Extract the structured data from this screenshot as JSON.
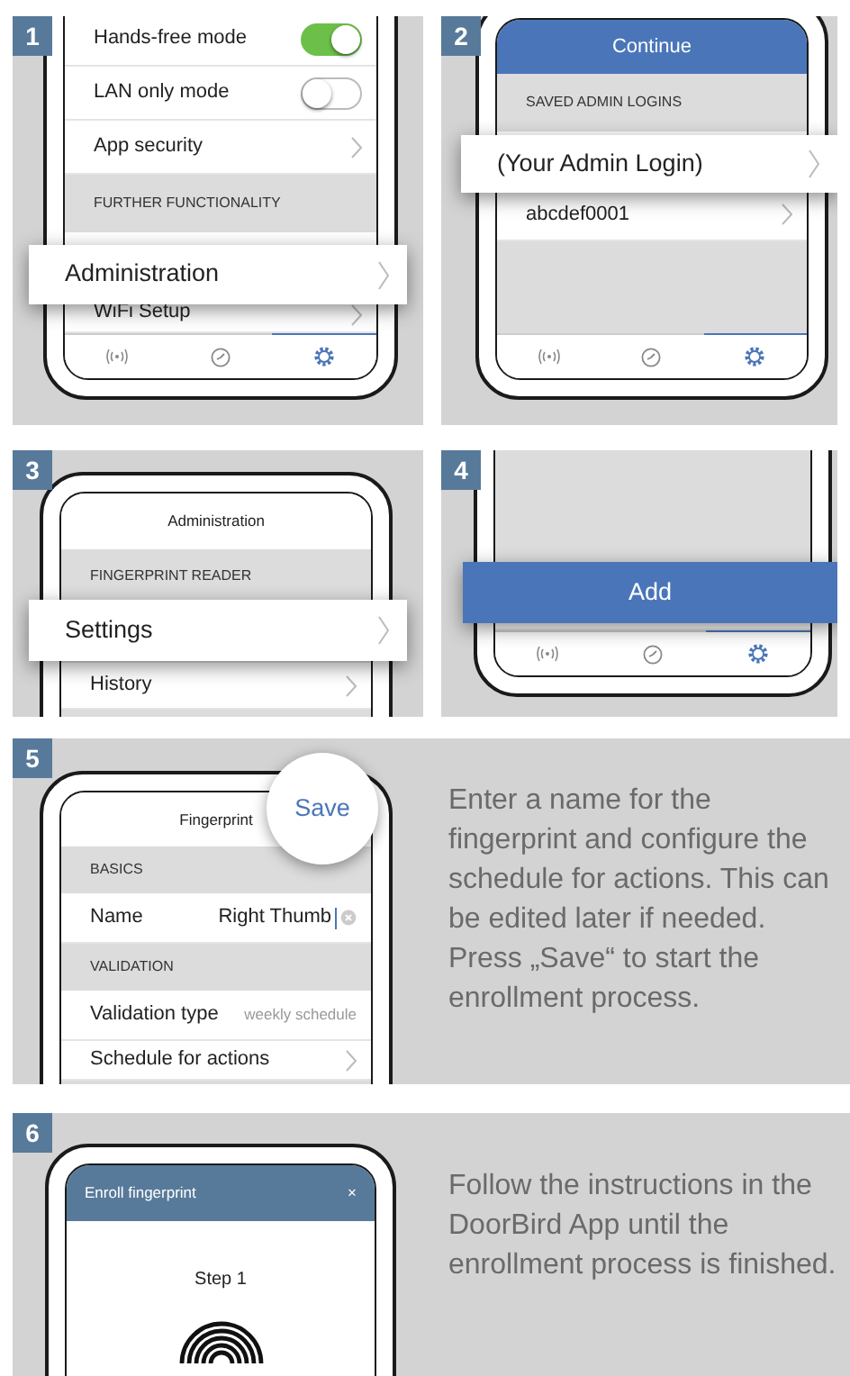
{
  "steps": [
    {
      "number": "1",
      "screen": {
        "rows": [
          {
            "kind": "toggle",
            "label": "Hands-free mode",
            "on": true
          },
          {
            "kind": "toggle",
            "label": "LAN only mode",
            "on": false
          },
          {
            "kind": "link",
            "label": "App security"
          },
          {
            "kind": "header",
            "label": "FURTHER FUNCTIONALITY"
          },
          {
            "kind": "blank"
          },
          {
            "kind": "link",
            "label": "WiFi Setup"
          }
        ]
      },
      "highlight": {
        "kind": "row",
        "label": "Administration"
      },
      "tabs": [
        {
          "kind": "signal",
          "selected": false
        },
        {
          "kind": "clock",
          "selected": false
        },
        {
          "kind": "gear",
          "selected": true
        }
      ]
    },
    {
      "number": "2",
      "screen": {
        "rows": [
          {
            "kind": "action",
            "label": "Continue"
          },
          {
            "kind": "header",
            "label": "SAVED ADMIN LOGINS"
          },
          {
            "kind": "blank"
          },
          {
            "kind": "link",
            "label": "abcdef0001"
          }
        ]
      },
      "highlight": {
        "kind": "row",
        "label": "(Your Admin Login)"
      },
      "tabs": [
        {
          "kind": "signal",
          "selected": false
        },
        {
          "kind": "clock",
          "selected": false
        },
        {
          "kind": "gear",
          "selected": true
        }
      ]
    },
    {
      "number": "3",
      "screen": {
        "rows": [
          {
            "kind": "title",
            "label": "Administration"
          },
          {
            "kind": "header",
            "label": "FINGERPRINT READER"
          },
          {
            "kind": "blank"
          },
          {
            "kind": "link",
            "label": "History"
          }
        ]
      },
      "highlight": {
        "kind": "row",
        "label": "Settings"
      }
    },
    {
      "number": "4",
      "screen": {
        "rows": [
          {
            "kind": "blank"
          }
        ]
      },
      "highlight": {
        "kind": "button",
        "label": "Add"
      },
      "tabs": [
        {
          "kind": "signal",
          "selected": false
        },
        {
          "kind": "clock",
          "selected": false
        },
        {
          "kind": "gear",
          "selected": true
        }
      ]
    },
    {
      "number": "5",
      "screen": {
        "rows": [
          {
            "kind": "title",
            "label": "Fingerprint"
          },
          {
            "kind": "header",
            "label": "BASICS"
          },
          {
            "kind": "input",
            "label": "Name",
            "value": "Right Thumb"
          },
          {
            "kind": "header",
            "label": "VALIDATION"
          },
          {
            "kind": "value",
            "label": "Validation type",
            "value": "weekly schedule"
          },
          {
            "kind": "link",
            "label": "Schedule for actions"
          }
        ]
      },
      "save": {
        "label": "Save"
      },
      "text": "Enter a name for the fingerprint and configure the schedule for actions. This can be edited later if needed. Press „Save“ to start the enrollment process."
    },
    {
      "number": "6",
      "dialog": {
        "title": "Enroll fingerprint",
        "close": "×",
        "step": "Step 1"
      },
      "text": "Follow the instructions in the DoorBird App until the enrollment process is finished."
    }
  ]
}
